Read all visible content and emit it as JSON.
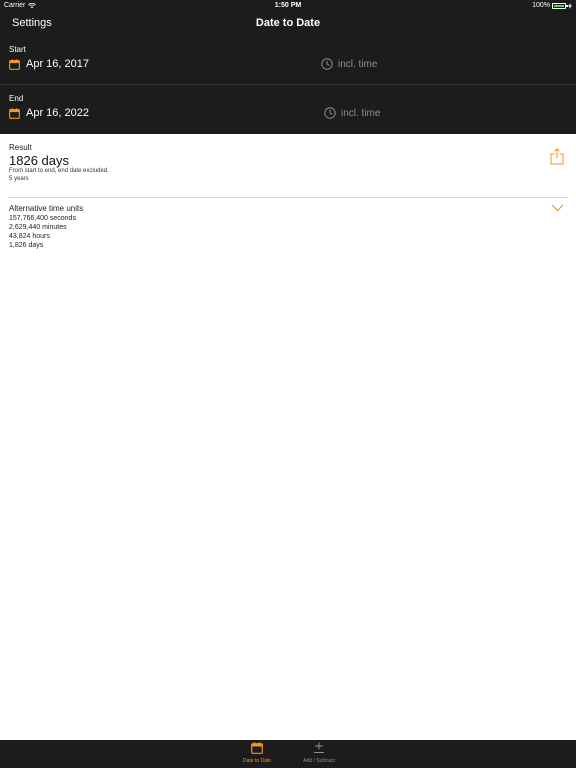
{
  "status_bar": {
    "carrier": "Carrier",
    "time": "1:50 PM",
    "battery": "100%"
  },
  "nav": {
    "left_button": "Settings",
    "title": "Date to Date"
  },
  "start": {
    "label": "Start",
    "date": "Apr 16, 2017",
    "time_toggle": "incl. time"
  },
  "end": {
    "label": "End",
    "date": "Apr 16, 2022",
    "time_toggle": "incl. time"
  },
  "result": {
    "label": "Result",
    "value": "1826 days",
    "description": "From start to end, end date excluded.",
    "years": "5 years"
  },
  "alternative": {
    "title": "Alternative time units",
    "items": [
      "157,766,400 seconds",
      "2,629,440 minutes",
      "43,824 hours",
      "1,826 days"
    ]
  },
  "tabs": [
    {
      "label": "Date to Date",
      "icon": "calendar-icon",
      "active": true
    },
    {
      "label": "Add / Subtract",
      "icon": "plus-minus-icon",
      "active": false
    }
  ],
  "colors": {
    "accent": "#f7931e",
    "dark_bg": "#1c1c1c",
    "muted_text": "#8e8e8e",
    "battery": "#4cd964"
  }
}
